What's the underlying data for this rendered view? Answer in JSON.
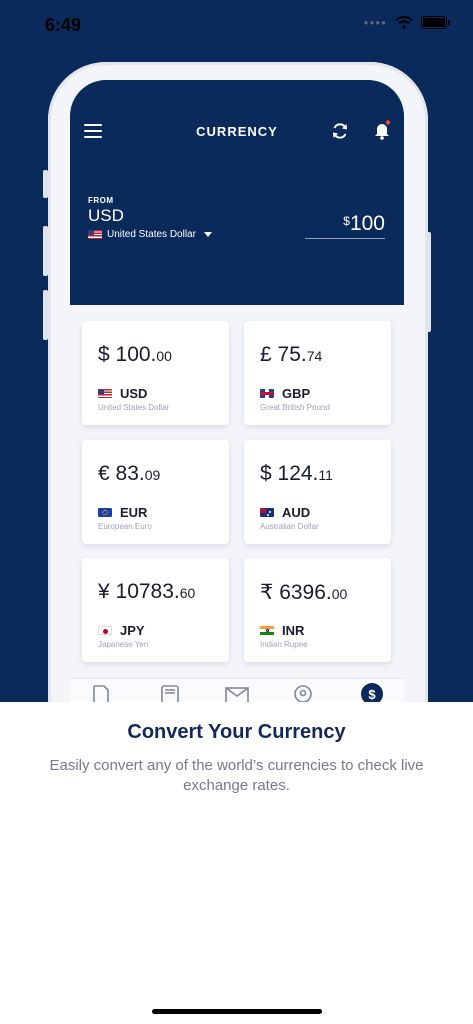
{
  "status_bar": {
    "time": "6:49"
  },
  "app": {
    "title": "CURRENCY",
    "from": {
      "label": "FROM",
      "code": "USD",
      "name": "United States Dollar",
      "amount_symbol": "$",
      "amount": "100"
    },
    "cards": [
      {
        "symbol_value": "$ 100.",
        "decimals": "00",
        "code": "USD",
        "name": "United States Dollar",
        "flag": "us"
      },
      {
        "symbol_value": "£ 75.",
        "decimals": "74",
        "code": "GBP",
        "name": "Great British Pound",
        "flag": "gb"
      },
      {
        "symbol_value": "€ 83.",
        "decimals": "09",
        "code": "EUR",
        "name": "European Euro",
        "flag": "eu"
      },
      {
        "symbol_value": "$ 124.",
        "decimals": "11",
        "code": "AUD",
        "name": "Australian Dollar",
        "flag": "au"
      },
      {
        "symbol_value": "¥ 10783.",
        "decimals": "60",
        "code": "JPY",
        "name": "Japanese Yen",
        "flag": "jp"
      },
      {
        "symbol_value": "₹ 6396.",
        "decimals": "00",
        "code": "INR",
        "name": "Indian Rupee",
        "flag": "in"
      }
    ],
    "bottom_nav_icons": [
      "document-icon",
      "wallet-icon",
      "mail-icon",
      "location-icon",
      "currency-icon"
    ]
  },
  "onboarding": {
    "title": "Convert Your Currency",
    "description": "Easily convert any of the world’s currencies to check live exchange rates."
  },
  "colors": {
    "navy": "#0b2a5c",
    "title_navy": "#13295a",
    "muted_text": "#737a8e"
  }
}
